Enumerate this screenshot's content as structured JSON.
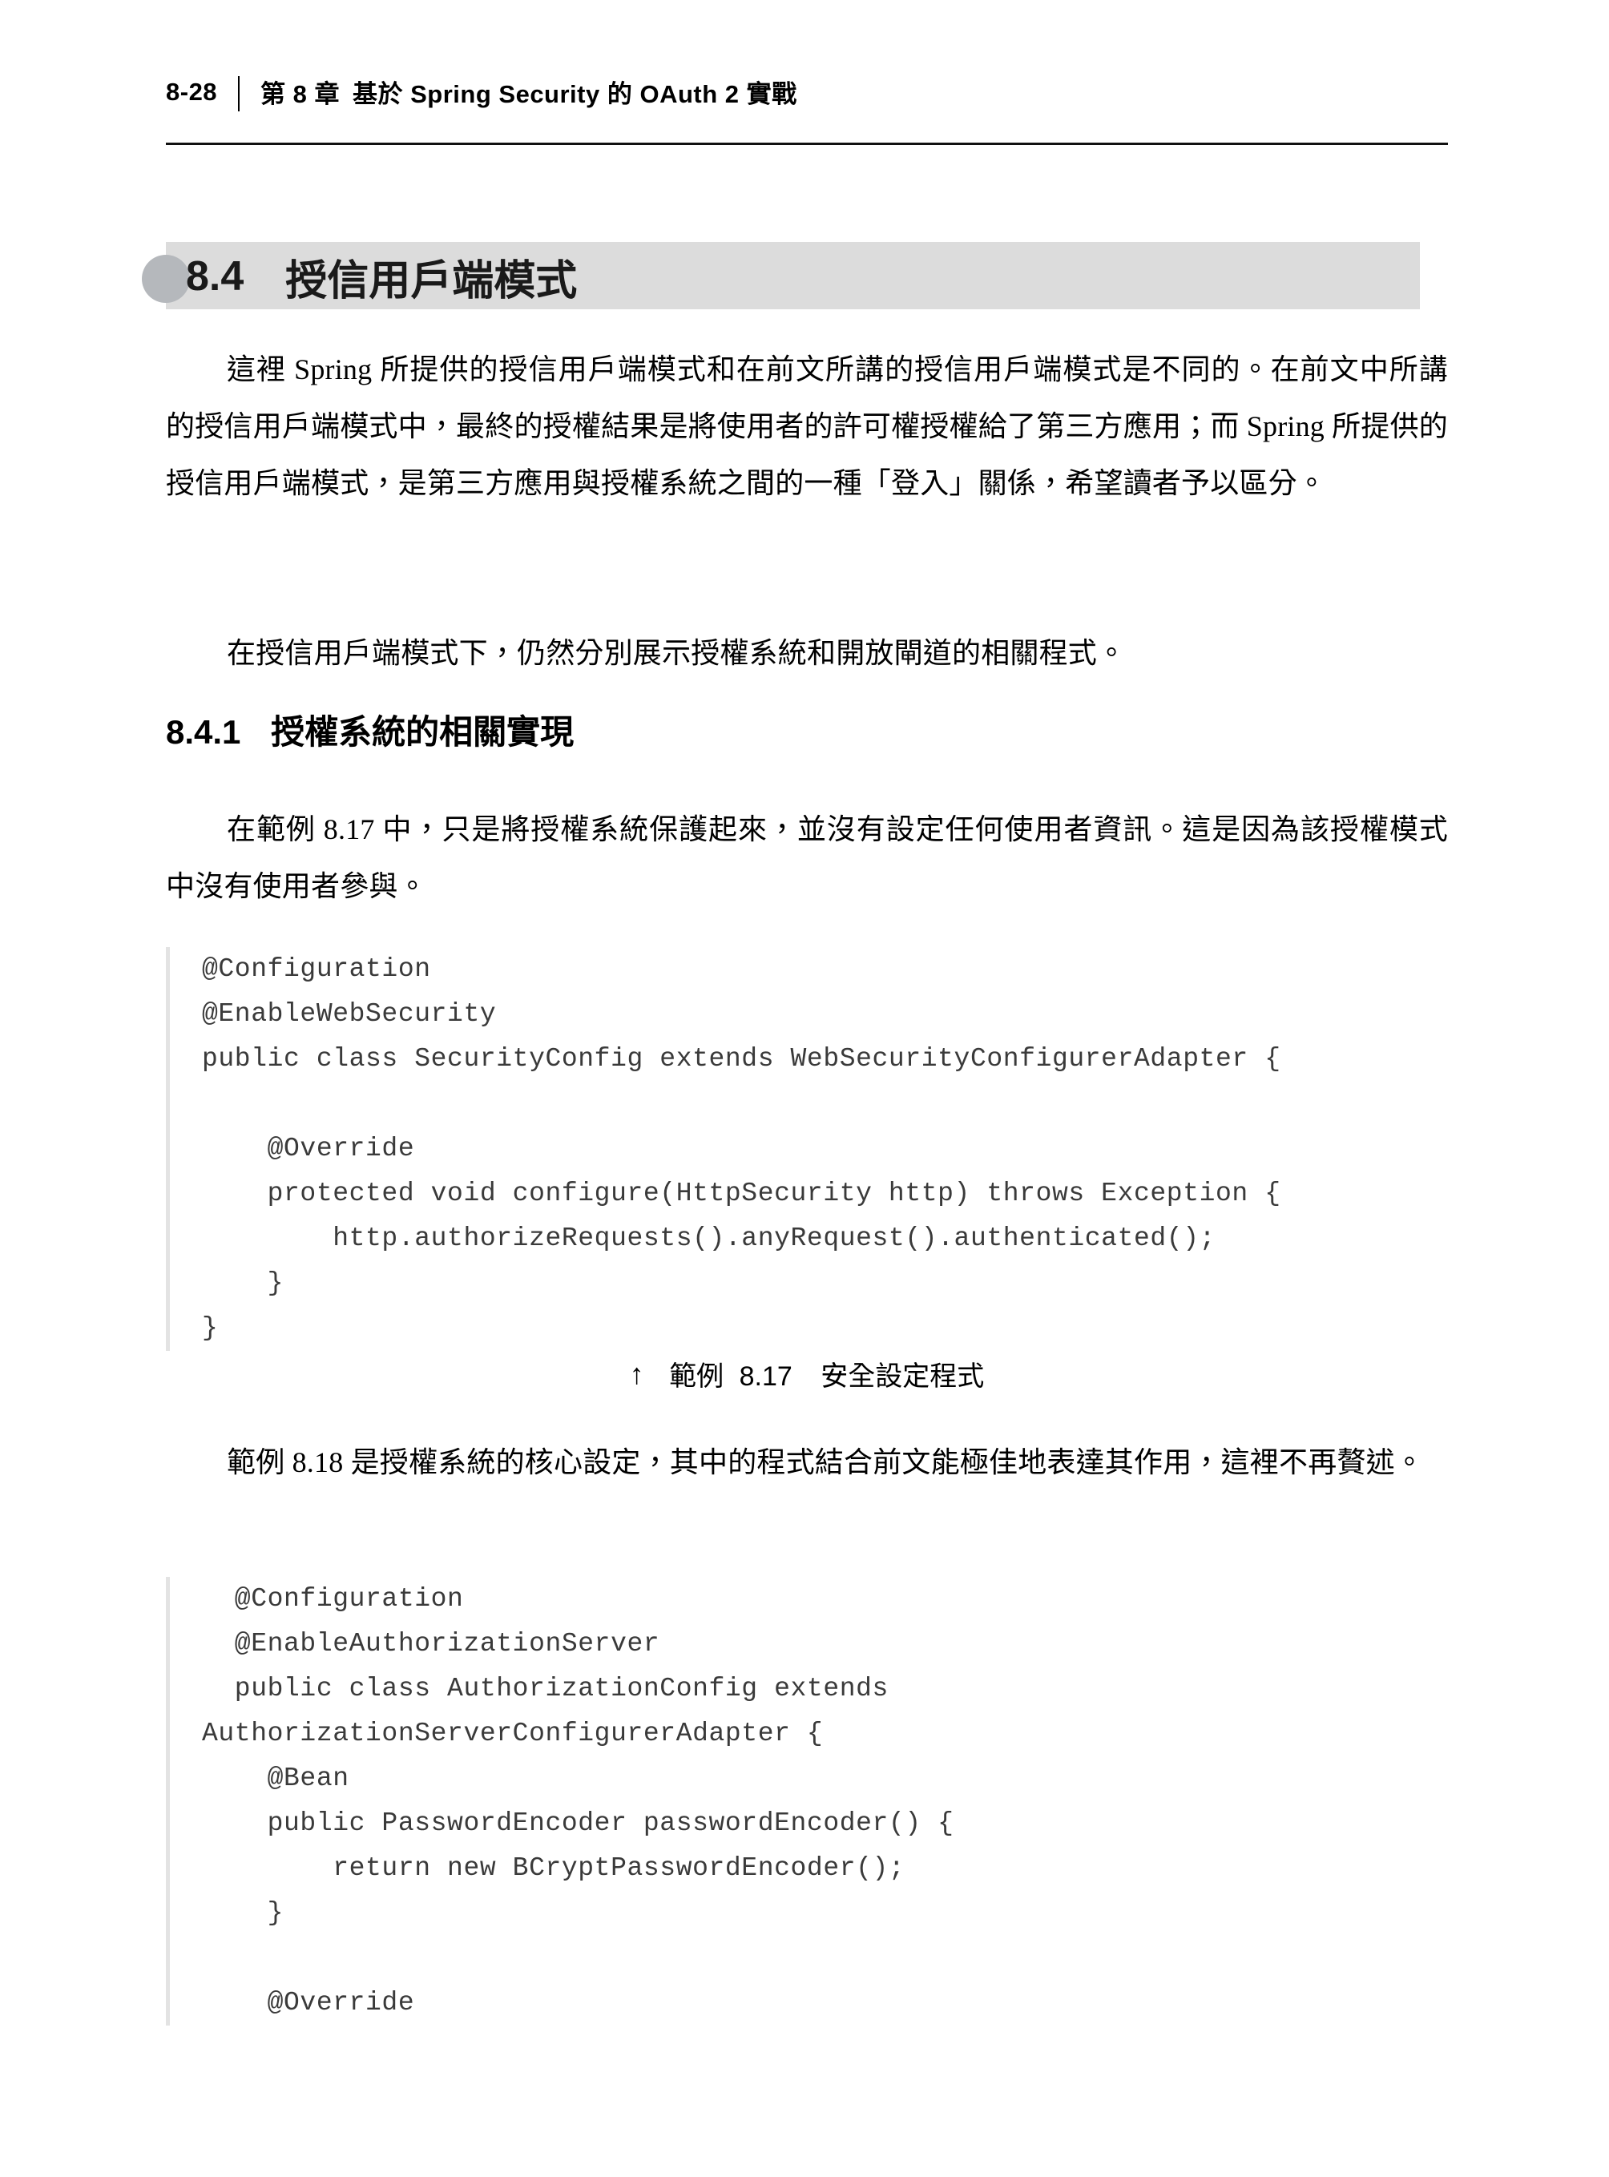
{
  "page": {
    "folio": "8-28",
    "chapter_number": "第 8 章",
    "chapter_title": "基於 Spring Security 的 OAuth 2 實戰"
  },
  "section": {
    "number": "8.4",
    "title": "授信用戶端模式"
  },
  "paragraphs": {
    "p1": "這裡 Spring 所提供的授信用戶端模式和在前文所講的授信用戶端模式是不同的。在前文中所講的授信用戶端模式中，最終的授權結果是將使用者的許可權授權給了第三方應用；而 Spring 所提供的授信用戶端模式，是第三方應用與授權系統之間的一種「登入」關係，希望讀者予以區分。",
    "p2": "在授信用戶端模式下，仍然分別展示授權系統和開放閘道的相關程式。",
    "p3": "在範例 8.17 中，只是將授權系統保護起來，並沒有設定任何使用者資訊。這是因為該授權模式中沒有使用者參與。",
    "p4": "範例 8.18 是授權系統的核心設定，其中的程式結合前文能極佳地表達其作用，這裡不再贅述。"
  },
  "subsection": {
    "number": "8.4.1",
    "title": "授權系統的相關實現"
  },
  "code_block_1": {
    "lines": [
      "@Configuration",
      "@EnableWebSecurity",
      "public class SecurityConfig extends WebSecurityConfigurerAdapter {",
      "",
      "    @Override",
      "    protected void configure(HttpSecurity http) throws Exception {",
      "        http.authorizeRequests().anyRequest().authenticated();",
      "    }",
      "}"
    ]
  },
  "figure_caption_1": {
    "mark": "↑",
    "label": "範例",
    "number": "8.17",
    "text": "安全設定程式"
  },
  "code_block_2": {
    "lines": [
      "  @Configuration",
      "  @EnableAuthorizationServer",
      "  public class AuthorizationConfig extends",
      "AuthorizationServerConfigurerAdapter {",
      "    @Bean",
      "    public PasswordEncoder passwordEncoder() {",
      "        return new BCryptPasswordEncoder();",
      "    }",
      "",
      "    @Override"
    ]
  },
  "colors": {
    "band": "#dcdcdc",
    "band_dot": "#b5b8bc",
    "code_rule": "#e3e3e3",
    "code_text": "#3a3a3a",
    "head_rule": "#111111"
  }
}
